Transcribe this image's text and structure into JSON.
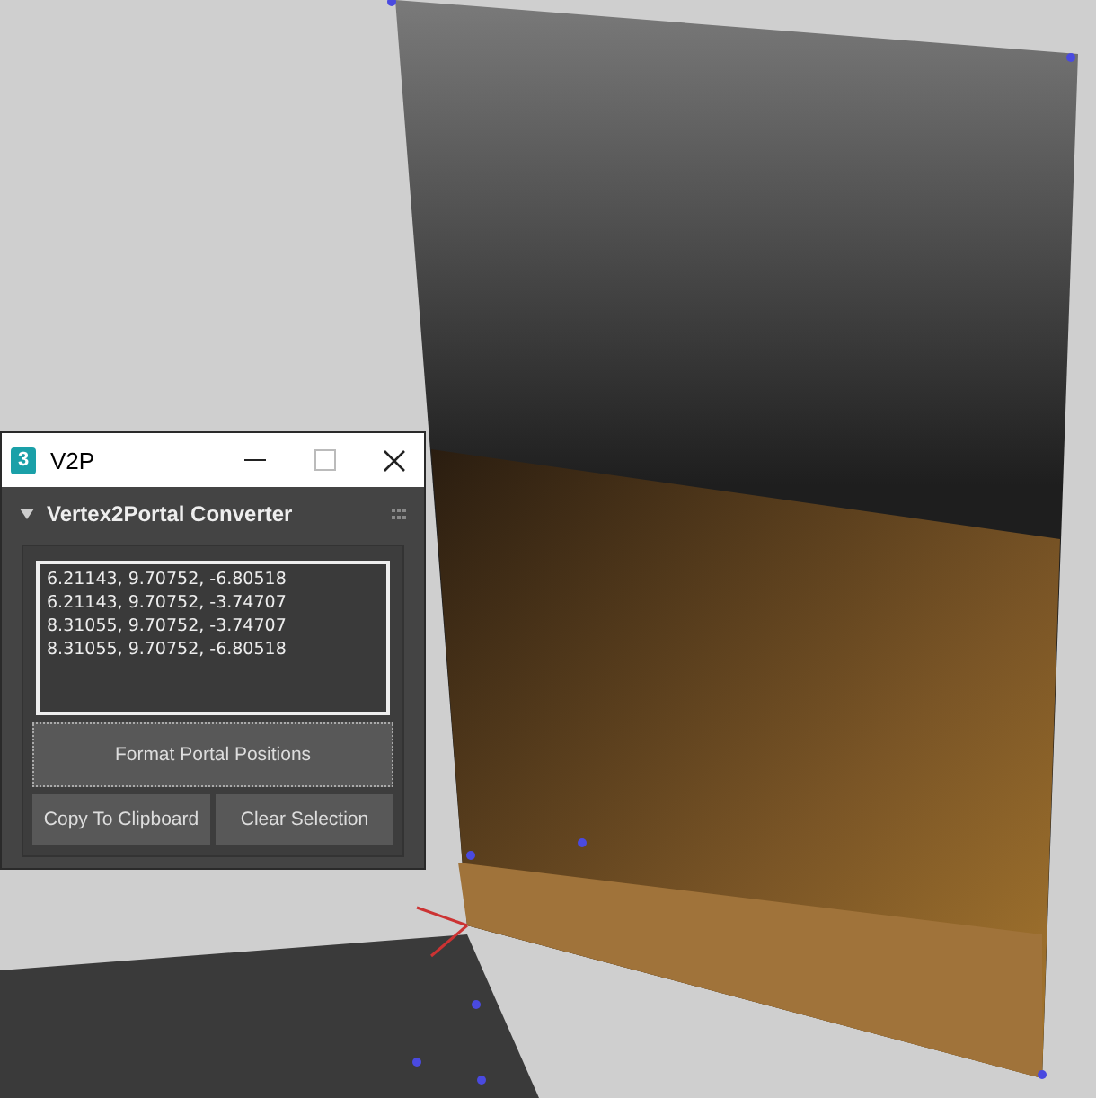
{
  "window": {
    "icon_text": "3",
    "title": "V2P"
  },
  "rollout": {
    "title": "Vertex2Portal Converter",
    "expanded": true,
    "positions": [
      "6.21143, 9.70752, -6.80518",
      "6.21143, 9.70752, -3.74707",
      "8.31055, 9.70752, -3.74707",
      "8.31055, 9.70752, -6.80518"
    ],
    "format_button": "Format Portal Positions",
    "buttons": [
      "Copy To Clipboard",
      "Clear Selection"
    ]
  }
}
